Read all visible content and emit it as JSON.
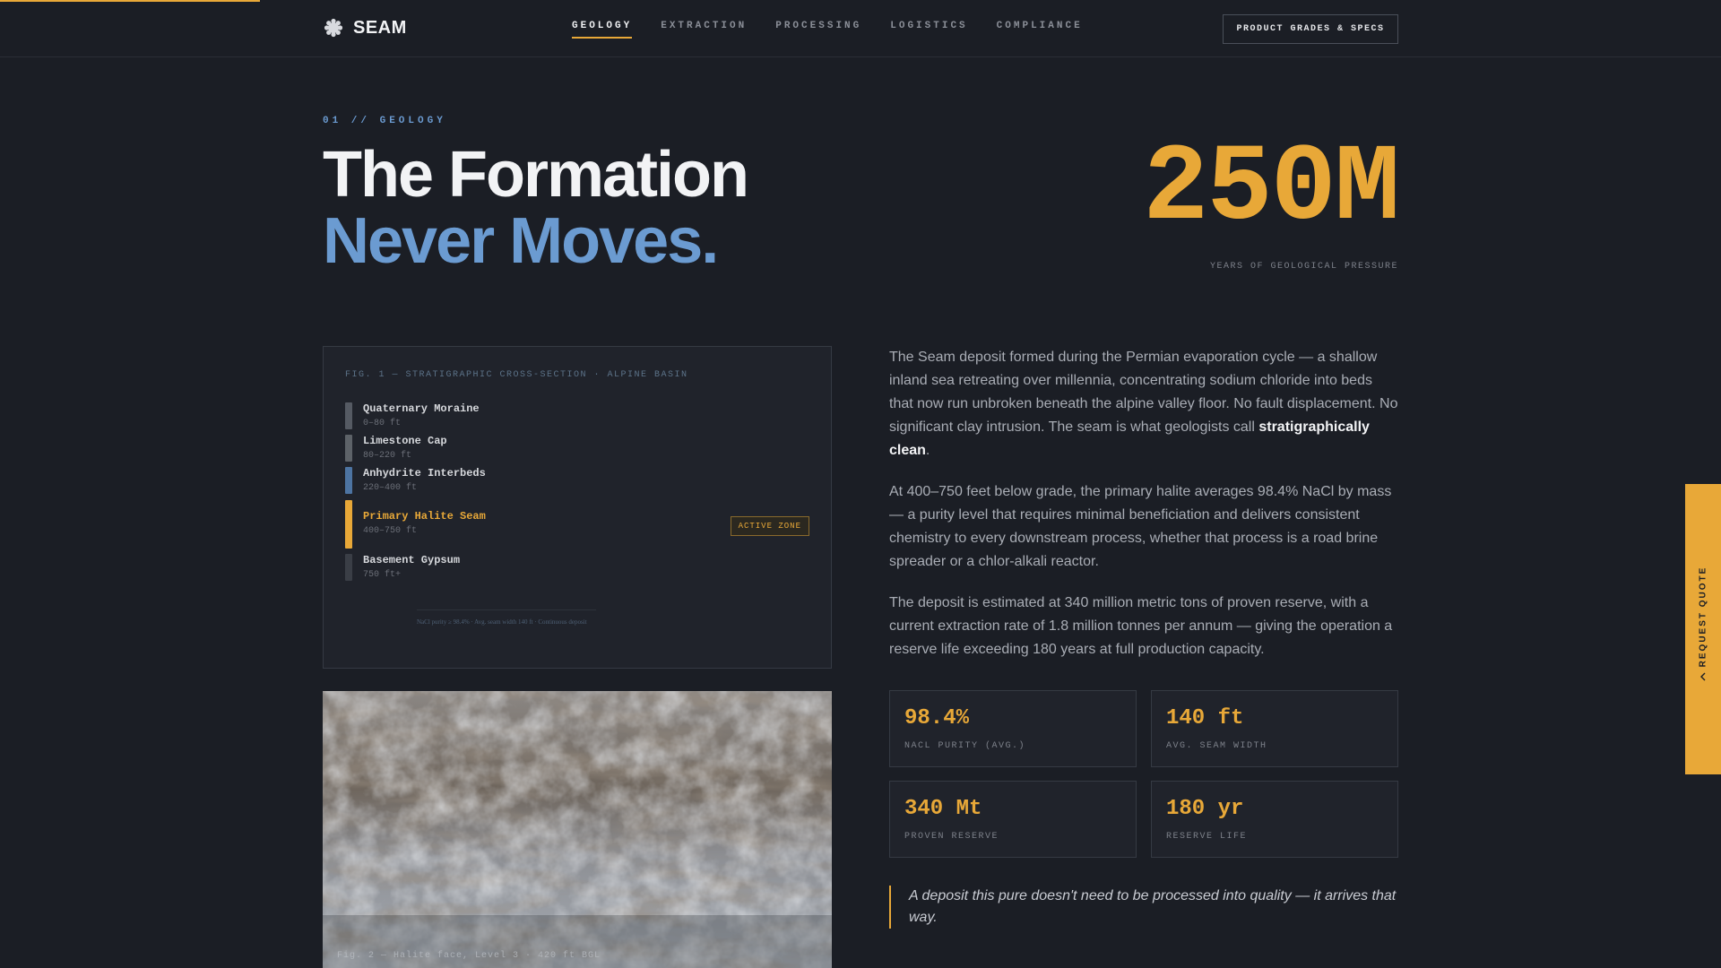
{
  "brand": {
    "name": "SEAM",
    "icon": "cog-crystal-icon"
  },
  "nav": {
    "links": [
      {
        "label": "GEOLOGY",
        "active": true
      },
      {
        "label": "EXTRACTION",
        "active": false
      },
      {
        "label": "PROCESSING",
        "active": false
      },
      {
        "label": "LOGISTICS",
        "active": false
      },
      {
        "label": "COMPLIANCE",
        "active": false
      }
    ],
    "cta": "PRODUCT GRADES & SPECS"
  },
  "hero": {
    "eyebrow": "01 // GEOLOGY",
    "title_line1": "The Formation",
    "title_line2": "Never Moves.",
    "big_number": "250M",
    "big_number_caption": "YEARS OF GEOLOGICAL PRESSURE"
  },
  "stratigraphy": {
    "title": "FIG. 1 — STRATIGRAPHIC CROSS-SECTION · ALPINE BASIN",
    "layers": [
      {
        "name": "Quaternary Moraine",
        "depth": "0–80 ft"
      },
      {
        "name": "Limestone Cap",
        "depth": "80–220 ft"
      },
      {
        "name": "Anhydrite Interbeds",
        "depth": "220–400 ft"
      },
      {
        "name": "Primary Halite Seam",
        "depth": "400–750 ft"
      },
      {
        "name": "Basement Gypsum",
        "depth": "750 ft+"
      }
    ],
    "active_badge": "ACTIVE ZONE",
    "footer": "NaCl purity ≥ 98.4% · Avg. seam width 140 ft · Continuous deposit"
  },
  "photo": {
    "caption": "Fig. 2 — Halite face, Level 3 · 420 ft BGL"
  },
  "body": {
    "p1_a": "The Seam deposit formed during the Permian evaporation cycle — a shallow inland sea retreating over millennia, concentrating sodium chloride into beds that now run unbroken beneath the alpine valley floor. No fault displacement. No significant clay intrusion. The seam is what geologists call ",
    "p1_strong": "stratigraphically clean",
    "p1_end": ".",
    "p2": "At 400–750 feet below grade, the primary halite averages 98.4% NaCl by mass — a purity level that requires minimal beneficiation and delivers consistent chemistry to every downstream process, whether that process is a road brine spreader or a chlor-alkali reactor.",
    "p3": "The deposit is estimated at 340 million metric tons of proven reserve, with a current extraction rate of 1.8 million tonnes per annum — giving the operation a reserve life exceeding 180 years at full production capacity."
  },
  "stats": [
    {
      "value": "98.4%",
      "label": "NACL PURITY (AVG.)"
    },
    {
      "value": "140 ft",
      "label": "AVG. SEAM WIDTH"
    },
    {
      "value": "340 Mt",
      "label": "PROVEN RESERVE"
    },
    {
      "value": "180 yr",
      "label": "RESERVE LIFE"
    }
  ],
  "quote": "A deposit this pure doesn't need to be processed into quality — it arrives that way.",
  "side_tab": {
    "label": "REQUEST QUOTE",
    "icon": "chevron-left-icon"
  },
  "colors": {
    "accent": "#e8a838",
    "blue": "#6b9bd1",
    "background": "#1b1e25"
  }
}
